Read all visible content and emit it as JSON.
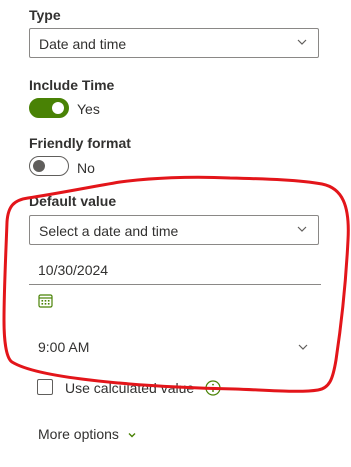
{
  "type_section": {
    "label": "Type",
    "selected": "Date and time"
  },
  "include_time": {
    "label": "Include Time",
    "toggle_on": true,
    "state_text": "Yes"
  },
  "friendly_format": {
    "label": "Friendly format",
    "toggle_on": false,
    "state_text": "No"
  },
  "default_value": {
    "label": "Default value",
    "selected": "Select a date and time",
    "date": "10/30/2024",
    "time": "9:00 AM"
  },
  "calculated": {
    "label": "Use calculated value",
    "checked": false
  },
  "more_options": {
    "label": "More options"
  },
  "colors": {
    "toggle_on": "#498205",
    "annotation": "#e3151a",
    "calendar_icon": "#498205"
  },
  "icons": [
    "chevron-down-icon",
    "calendar-icon",
    "info-icon"
  ]
}
